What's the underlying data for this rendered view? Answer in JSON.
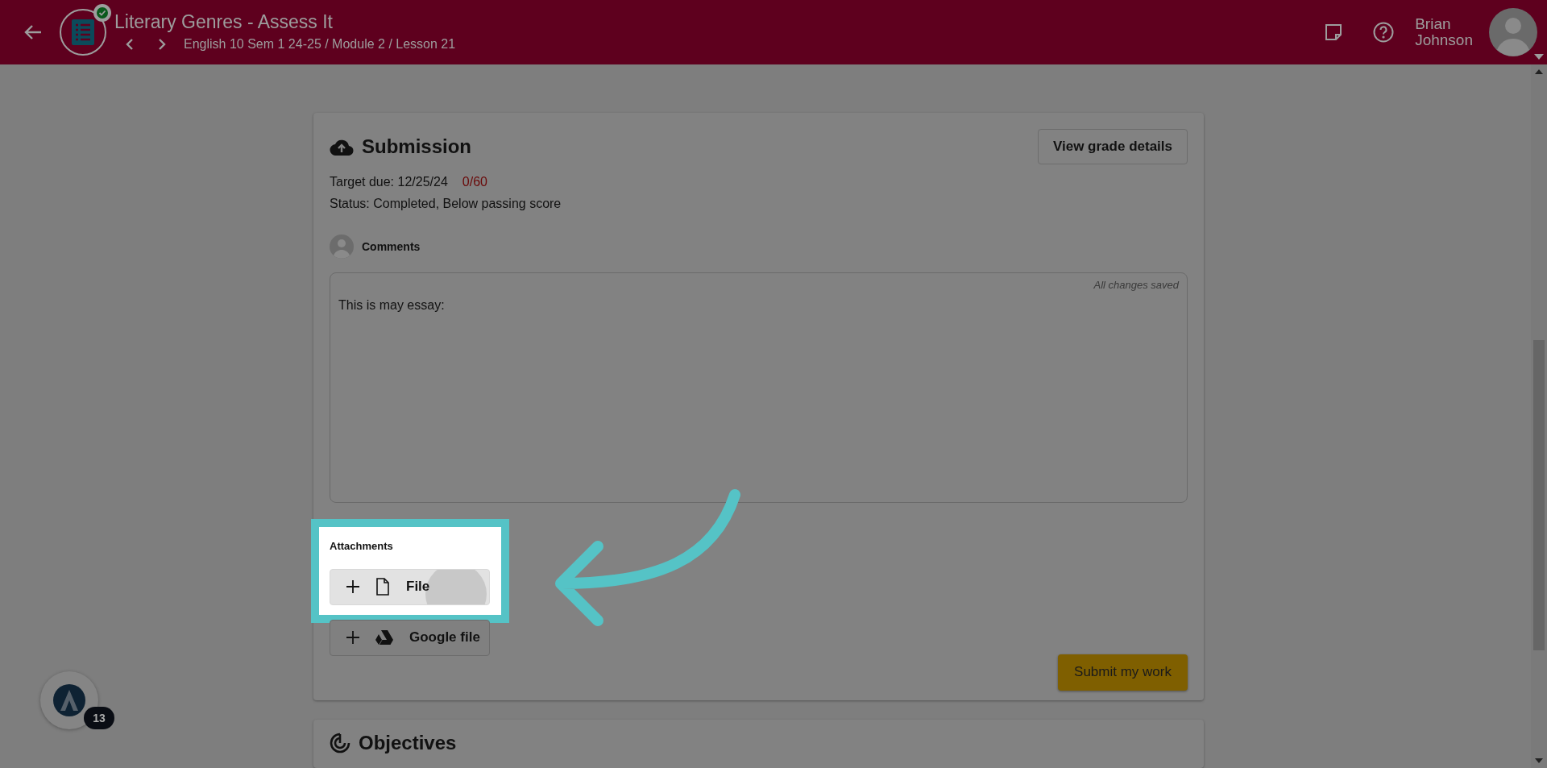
{
  "header": {
    "title": "Literary Genres - Assess It",
    "breadcrumb": "English 10 Sem 1 24-25 / Module 2 / Lesson 21",
    "user_first": "Brian",
    "user_last": "Johnson"
  },
  "submission": {
    "title": "Submission",
    "grade_button": "View grade details",
    "target_due": "Target due: 12/25/24",
    "score": "0/60",
    "status": "Status: Completed, Below passing score",
    "comments_label": "Comments",
    "editor": {
      "saved_note": "All changes saved",
      "text": "This is may essay:"
    },
    "attachments": {
      "label": "Attachments",
      "buttons": [
        {
          "kind": "file",
          "label": "File",
          "highlighted": true
        },
        {
          "kind": "drive",
          "label": "Google file",
          "highlighted": false
        }
      ]
    },
    "submit_button": "Submit my work"
  },
  "objectives": {
    "title": "Objectives"
  },
  "assistant": {
    "count": "13"
  }
}
